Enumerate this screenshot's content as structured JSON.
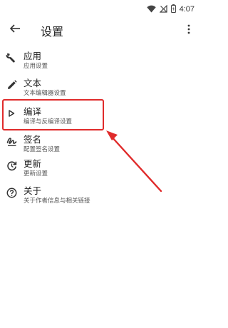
{
  "status_bar": {
    "time": "4:07",
    "icons": [
      "wifi-icon",
      "signal-blocked-icon",
      "battery-charging-icon"
    ]
  },
  "app_bar": {
    "title": "设置",
    "back_icon": "arrow-back-icon",
    "menu_icon": "more-vert-icon"
  },
  "settings": {
    "items": [
      {
        "title": "应用",
        "subtitle": "应用设置",
        "icon": "wrench-icon"
      },
      {
        "title": "文本",
        "subtitle": "文本编辑器设置",
        "icon": "pencil-icon"
      },
      {
        "title": "编译",
        "subtitle": "编译与反编译设置",
        "icon": "play-triangle-icon"
      },
      {
        "title": "签名",
        "subtitle": "配置签名设置",
        "icon": "signature-icon"
      },
      {
        "title": "更新",
        "subtitle": "更新设置",
        "icon": "update-clock-icon"
      },
      {
        "title": "关于",
        "subtitle": "关于作者信息与相关链接",
        "icon": "help-circle-icon"
      }
    ]
  },
  "annotation": {
    "highlight_color": "#e02b2b"
  }
}
